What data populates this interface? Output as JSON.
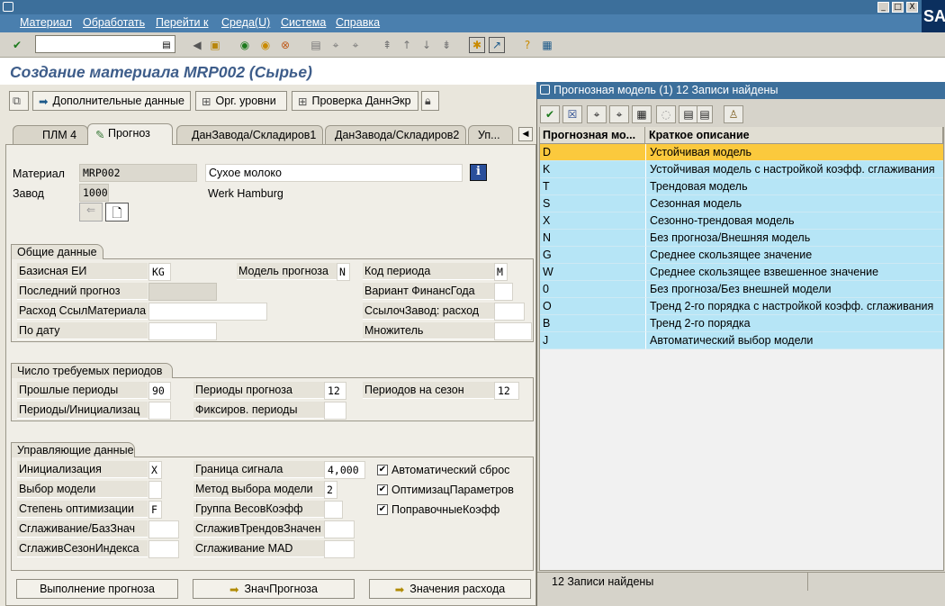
{
  "menu": [
    "Материал",
    "Обработать",
    "Перейти к",
    "Среда(U)",
    "Система",
    "Справка"
  ],
  "window_controls": {
    "minimize": "_",
    "restore": "□",
    "close": "X"
  },
  "sap_logo": "SAP",
  "page_title": "Создание материала MRP002 (Сырье)",
  "app_buttons": {
    "additional_data": "Дополнительные данные",
    "org_levels": "Орг. уровни",
    "check_screen_data": "Проверка ДаннЭкр"
  },
  "tabs": [
    "ПЛМ 4",
    "Прогноз",
    "ДанЗавода/Складиров1",
    "ДанЗавода/Складиров2",
    "Уп..."
  ],
  "header": {
    "material_label": "Материал",
    "material_value": "MRP002",
    "material_desc": "Сухое молоко",
    "plant_label": "Завод",
    "plant_value": "1000",
    "plant_desc": "Werk Hamburg"
  },
  "general": {
    "title": "Общие данные",
    "base_uom_label": "Базисная ЕИ",
    "base_uom_value": "KG",
    "forecast_model_label": "Модель прогноза",
    "forecast_model_value": "N",
    "period_code_label": "Код периода",
    "period_code_value": "M",
    "last_forecast_label": "Последний прогноз",
    "fiscal_variant_label": "Вариант ФинансГода",
    "ref_consumption_label": "Расход СсылМатериала",
    "ref_plant_label": "СсылочЗавод: расход",
    "to_date_label": "По дату",
    "multiplier_label": "Множитель"
  },
  "periods": {
    "title": "Число требуемых периодов",
    "past_label": "Прошлые периоды",
    "past_value": "90",
    "forecast_label": "Периоды прогноза",
    "forecast_value": "12",
    "season_label": "Периодов на сезон",
    "season_value": "12",
    "init_label": "Периоды/Инициализац",
    "fixed_label": "Фиксиров. периоды"
  },
  "control": {
    "title": "Управляющие данные",
    "init_label": "Инициализация",
    "init_value": "X",
    "signal_label": "Граница сигнала",
    "signal_value": "4,000",
    "auto_reset_label": "Автоматический сброс",
    "model_sel_label": "Выбор модели",
    "model_method_label": "Метод выбора модели",
    "model_method_value": "2",
    "opt_params_label": "ОптимизацПараметров",
    "opt_level_label": "Степень оптимизации",
    "opt_level_value": "F",
    "weight_group_label": "Группа ВесовКоэфф",
    "corr_factors_label": "ПоправочныеКоэфф",
    "smooth_base_label": "Сглаживание/БазЗнач",
    "smooth_trend_label": "СглаживТрендовЗначен",
    "smooth_season_label": "СглаживСезонИндекса",
    "smooth_mad_label": "Сглаживание MAD"
  },
  "bottom_buttons": {
    "run_forecast": "Выполнение прогноза",
    "forecast_values": "ЗначПрогноза",
    "consumption_values": "Значения расхода"
  },
  "popup": {
    "title": "Прогнозная модель (1)   12 Записи найдены",
    "col_code": "Прогнозная мо...",
    "col_desc": "Краткое описание",
    "rows": [
      {
        "code": "D",
        "desc": "Устойчивая модель"
      },
      {
        "code": "K",
        "desc": "Устойчивая модель с настройкой коэфф. сглаживания"
      },
      {
        "code": "T",
        "desc": "Трендовая модель"
      },
      {
        "code": "S",
        "desc": "Сезонная модель"
      },
      {
        "code": "X",
        "desc": "Сезонно-трендовая модель"
      },
      {
        "code": "N",
        "desc": "Без прогноза/Внешняя модель"
      },
      {
        "code": "G",
        "desc": "Среднее скользящее значение"
      },
      {
        "code": "W",
        "desc": "Среднее скользящее взвешенное значение"
      },
      {
        "code": "0",
        "desc": "Без прогноза/Без внешней модели"
      },
      {
        "code": "O",
        "desc": "Тренд 2-го порядка с настройкой коэфф. сглаживания"
      },
      {
        "code": "B",
        "desc": "Тренд 2-го порядка"
      },
      {
        "code": "J",
        "desc": "Автоматический выбор модели"
      }
    ],
    "status": "12 Записи найдены"
  },
  "colors": {
    "title_blue": "#3e5d8a",
    "menu_bg": "#4a7fae",
    "row_bg": "#b6e5f6",
    "row_selected": "#fbc93d"
  }
}
